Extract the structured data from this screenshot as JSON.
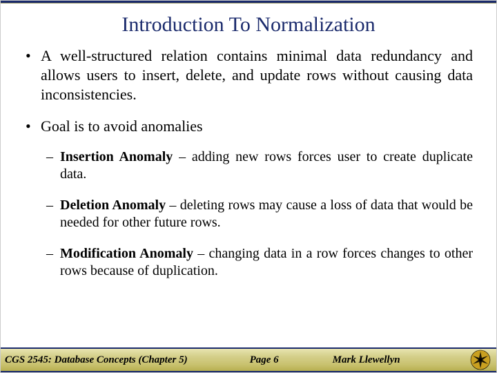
{
  "title": "Introduction To Normalization",
  "bullets": [
    "A well-structured relation contains minimal data redundancy and allows users to insert, delete, and update rows without causing data inconsistencies.",
    "Goal is to avoid anomalies"
  ],
  "anomalies": [
    {
      "name": "Insertion Anomaly",
      "desc": " – adding new rows forces user to create duplicate data."
    },
    {
      "name": "Deletion Anomaly",
      "desc": " – deleting rows may cause a loss of data that would be needed for other future rows."
    },
    {
      "name": "Modification Anomaly",
      "desc": " – changing data in a row forces changes to other rows because of duplication."
    }
  ],
  "footer": {
    "course": "CGS 2545: Database Concepts  (Chapter 5)",
    "page": "Page 6",
    "author": "Mark Llewellyn"
  }
}
